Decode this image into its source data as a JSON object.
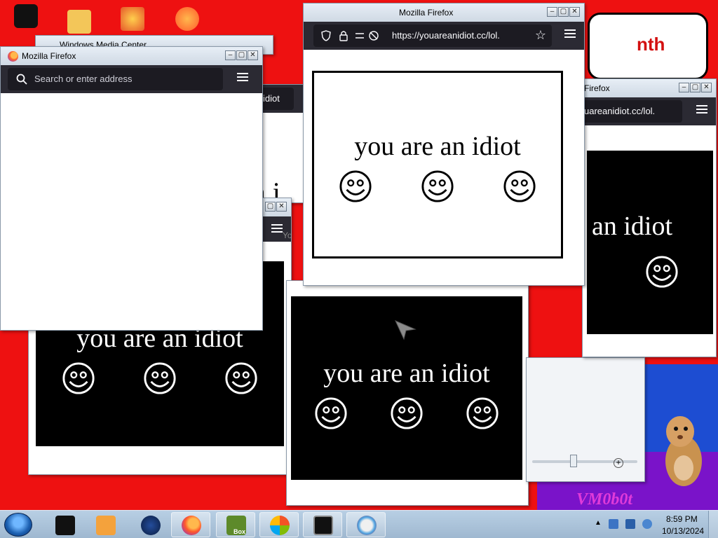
{
  "desktop": {
    "wallpaper_text": "nth",
    "corner_label": "VM0b0t",
    "partial_title_text": "Windows Media Center",
    "partial_overlay_text": "reanidiot"
  },
  "windows": {
    "front": {
      "title": "Mozilla Firefox",
      "url_placeholder": "Search or enter address"
    },
    "top": {
      "title": "Mozilla Firefox",
      "url": "https://youareanidiot.cc/lol.",
      "headline": "you are an idiot"
    },
    "right": {
      "title": "Firefox",
      "url": "uareanidiot.cc/lol.",
      "headline": "an idiot"
    },
    "middle": {
      "headline": "you are an idiot"
    },
    "lower_left": {
      "headline": "you are an idiot",
      "fragment": "Yo"
    },
    "behind": {
      "fragment": "an i"
    }
  },
  "taskbar": {
    "time": "8:59 PM",
    "date": "10/13/2024",
    "box_label": "Box"
  },
  "colors": {
    "wallpaper_red": "#ee1111",
    "firefox_toolbar": "#2b2a33",
    "taskbar": "#b8cfe4"
  },
  "icons": [
    "windows-start-orb",
    "media-player-icon",
    "firefox-icon",
    "vm-box-icon",
    "windows-icon",
    "terminal-icon",
    "paint-icon"
  ]
}
